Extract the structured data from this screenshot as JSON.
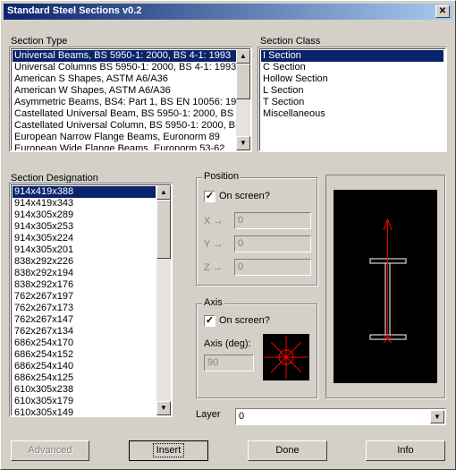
{
  "window": {
    "title": "Standard Steel Sections v0.2",
    "close_glyph": "✕"
  },
  "section_type": {
    "label": "Section Type",
    "items": [
      "Universal Beams, BS 5950-1: 2000, BS 4-1: 1993",
      "Universal Columns BS 5950-1: 2000, BS 4-1: 1993",
      "American S Shapes, ASTM A6/A36",
      "American W Shapes, ASTM A6/A36",
      "Asymmetric Beams, BS4: Part 1, BS EN 10056: 1999",
      "Castellated Universal Beam, BS 5950-1: 2000, BS 4-",
      "Castellated Universal Column, BS 5950-1: 2000, BS 4",
      "European Narrow Flange Beams, Euronorm 89",
      "European Wide Flange Beams, Euronorm 53-62"
    ],
    "selected_index": 0
  },
  "section_class": {
    "label": "Section Class",
    "items": [
      "I Section",
      "C Section",
      "Hollow Section",
      "L Section",
      "T Section",
      "Miscellaneous"
    ],
    "selected_index": 0
  },
  "section_designation": {
    "label": "Section Designation",
    "items": [
      "914x419x388",
      "914x419x343",
      "914x305x289",
      "914x305x253",
      "914x305x224",
      "914x305x201",
      "838x292x226",
      "838x292x194",
      "838x292x176",
      "762x267x197",
      "762x267x173",
      "762x267x147",
      "762x267x134",
      "686x254x170",
      "686x254x152",
      "686x254x140",
      "686x254x125",
      "610x305x238",
      "610x305x179",
      "610x305x149"
    ],
    "selected_index": 0
  },
  "position": {
    "label": "Position",
    "on_screen_label": "On screen?",
    "on_screen_checked": true,
    "check_glyph": "✓",
    "x_label": "X",
    "y_label": "Y",
    "z_label": "Z",
    "x_value": "0",
    "y_value": "0",
    "z_value": "0"
  },
  "axis": {
    "label": "Axis",
    "on_screen_label": "On screen?",
    "on_screen_checked": true,
    "deg_label": "Axis (deg):",
    "deg_value": "90"
  },
  "layer": {
    "label": "Layer",
    "value": "0"
  },
  "buttons": {
    "advanced": "Advanced",
    "insert": "Insert",
    "done": "Done",
    "info": "Info"
  },
  "colors": {
    "accent": "#0a246a",
    "preview_bg": "#000000",
    "section_line": "#ffffff",
    "axis_line": "#ff0000"
  },
  "icons": {
    "scroll_up": "▲",
    "scroll_down": "▼",
    "combo_arrow": "▼"
  }
}
